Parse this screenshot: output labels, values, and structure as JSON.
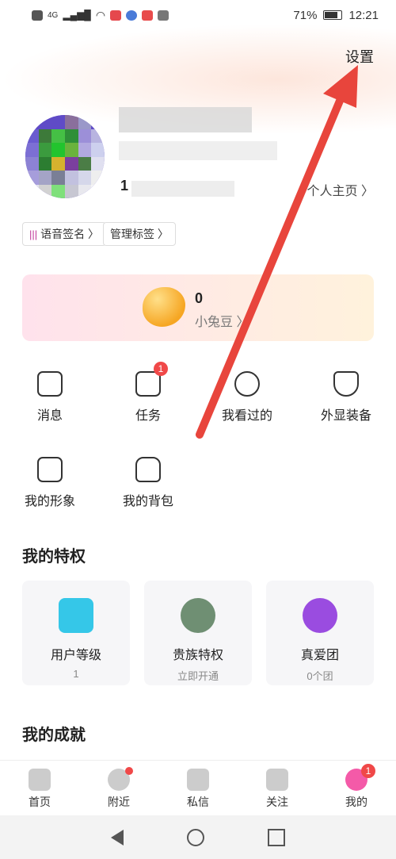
{
  "status_bar": {
    "network": "4G",
    "battery": "71%",
    "time": "12:21"
  },
  "header": {
    "settings_label": "设置"
  },
  "profile": {
    "count_prefix": "1",
    "homepage_label": "个人主页 〉",
    "tags": [
      {
        "label": "语音签名 〉"
      },
      {
        "label": "管理标签 〉"
      }
    ]
  },
  "beans": {
    "count": "0",
    "label": "小兔豆 〉"
  },
  "menu": {
    "items": [
      {
        "label": "消息"
      },
      {
        "label": "任务",
        "badge": "1"
      },
      {
        "label": "我看过的"
      },
      {
        "label": "外显装备"
      },
      {
        "label": "我的形象"
      },
      {
        "label": "我的背包"
      }
    ]
  },
  "privileges": {
    "title": "我的特权",
    "cards": [
      {
        "title": "用户等级",
        "sub": "1",
        "color": "#35c7e8"
      },
      {
        "title": "贵族特权",
        "sub": "立即开通",
        "color": "#6f8f73"
      },
      {
        "title": "真爱团",
        "sub": "0个团",
        "color": "#9a4ce0"
      }
    ]
  },
  "achievements": {
    "title": "我的成就"
  },
  "tabbar": {
    "tabs": [
      {
        "label": "首页"
      },
      {
        "label": "附近"
      },
      {
        "label": "私信"
      },
      {
        "label": "关注"
      },
      {
        "label": "我的",
        "badge": "1"
      }
    ]
  },
  "colors": {
    "accent_red": "#f04848",
    "arrow_red": "#e8453c"
  }
}
